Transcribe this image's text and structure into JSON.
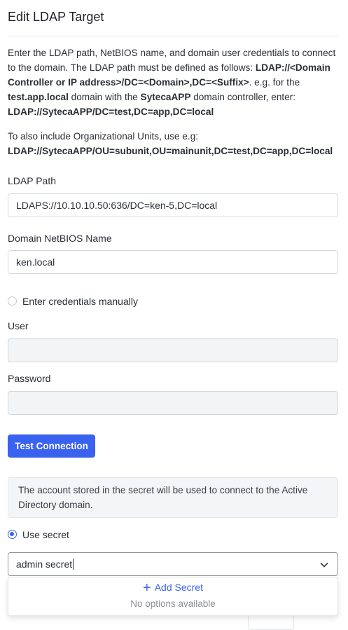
{
  "title": "Edit LDAP Target",
  "description": {
    "p1_part1": "Enter the LDAP path, NetBIOS name, and domain user credentials to connect to the domain. The LDAP path must be defined as follows: ",
    "p1_format": "LDAP://<Domain Controller or IP address>/DC=<Domain>,DC=<Suffix>",
    "p1_part2": ". e.g. for the ",
    "p1_domain": "test.app.local",
    "p1_part3": " domain with the ",
    "p1_controller": "SytecaAPP",
    "p1_part4": " domain controller, enter: ",
    "p1_example": "LDAP://SytecaAPP/DC=test,DC=app,DC=local",
    "p2_text": "To also include Organizational Units, use e.g: ",
    "p2_example": "LDAP://SytecaAPP/OU=subunit,OU=mainunit,DC=test,DC=app,DC=local"
  },
  "ldap_path": {
    "label": "LDAP Path",
    "value": "LDAPS://10.10.10.50:636/DC=ken-5,DC=local"
  },
  "netbios": {
    "label": "Domain NetBIOS Name",
    "value": "ken.local"
  },
  "credentials_manual": {
    "label": "Enter credentials manually",
    "checked": false
  },
  "user": {
    "label": "User",
    "value": ""
  },
  "password": {
    "label": "Password",
    "value": ""
  },
  "test_button": "Test Connection",
  "info_text": "The account stored in the secret will be used to connect to the Active Directory domain.",
  "use_secret": {
    "label": "Use secret",
    "checked": true
  },
  "secret_select": {
    "value": "admin secret"
  },
  "dropdown": {
    "add_label": "Add Secret",
    "add_icon": "+",
    "empty_label": "No options available"
  },
  "colors": {
    "accent": "#3a62f0",
    "text": "#2b2f36",
    "muted": "#8c9198"
  }
}
